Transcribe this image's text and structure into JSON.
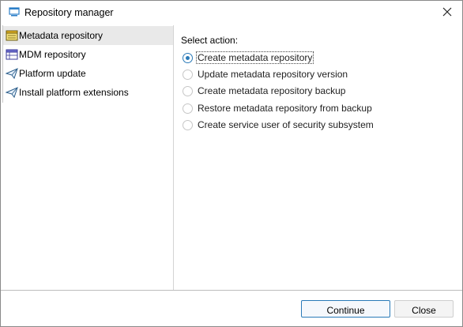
{
  "window": {
    "title": "Repository manager"
  },
  "sidebar": {
    "items": [
      {
        "label": "Metadata repository",
        "icon": "metadata-repository-icon",
        "selected": true
      },
      {
        "label": "MDM repository",
        "icon": "mdm-repository-icon",
        "selected": false
      },
      {
        "label": "Platform update",
        "icon": "platform-update-icon",
        "selected": false
      },
      {
        "label": "Install platform extensions",
        "icon": "platform-extensions-icon",
        "selected": false
      }
    ]
  },
  "main": {
    "select_label": "Select action:",
    "options": [
      {
        "label": "Create metadata repository",
        "checked": true
      },
      {
        "label": "Update metadata repository version",
        "checked": false
      },
      {
        "label": "Create metadata repository backup",
        "checked": false
      },
      {
        "label": "Restore metadata repository from backup",
        "checked": false
      },
      {
        "label": "Create service user of security subsystem",
        "checked": false
      }
    ]
  },
  "footer": {
    "continue_label": "Continue",
    "close_label": "Close"
  },
  "colors": {
    "accent": "#2a7ab8",
    "selection": "#e9e9e9"
  }
}
